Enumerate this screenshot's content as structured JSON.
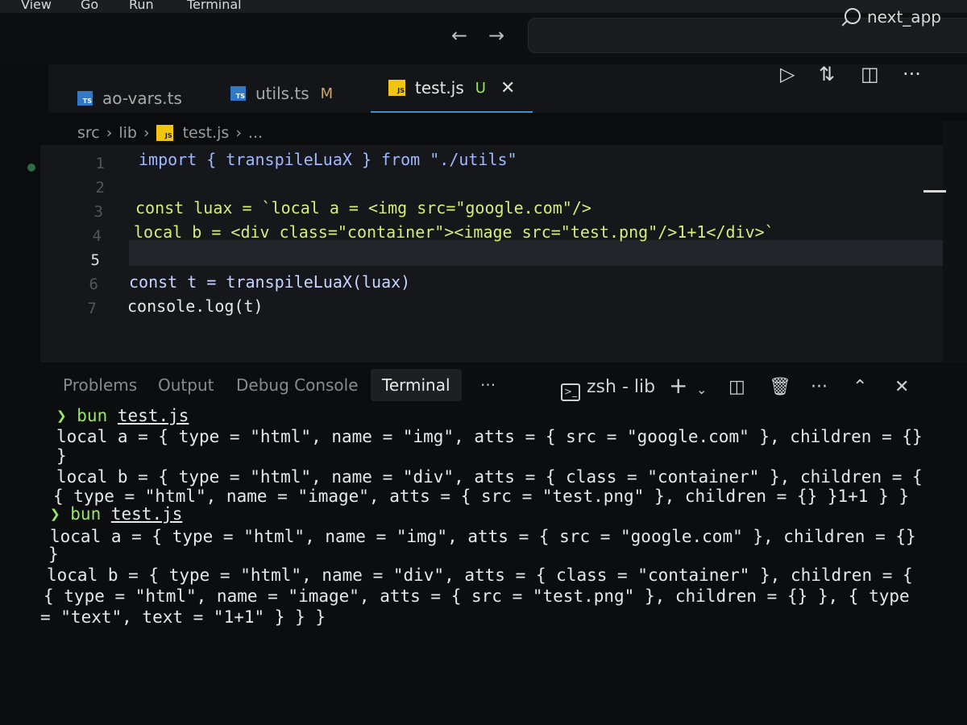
{
  "menu": [
    "View",
    "Go",
    "Run",
    "Terminal"
  ],
  "nav": {
    "back": "←",
    "forward": "→"
  },
  "app_name": "next_app",
  "tabs": [
    {
      "badge": "TS",
      "label": "ao-vars.ts",
      "status": ""
    },
    {
      "badge": "TS",
      "label": "utils.ts",
      "status": "M"
    },
    {
      "badge": "JS",
      "label": "test.js",
      "status": "U"
    }
  ],
  "breadcrumb": {
    "part1": "src",
    "part2": "lib",
    "file": "test.js",
    "more": "..."
  },
  "editor": {
    "line_numbers": [
      "1",
      "2",
      "3",
      "4",
      "5",
      "6",
      "7"
    ],
    "lines": [
      "import { transpileLuaX } from \"./utils\"",
      "",
      "const luax = `local a = <img src=\"google.com\"/>",
      "local b = <div class=\"container\"><image src=\"test.png\"/>1+1</div>`",
      "",
      "const t = transpileLuaX(luax)",
      "console.log(t)"
    ]
  },
  "panel": {
    "tabs": [
      "Problems",
      "Output",
      "Debug Console",
      "Terminal"
    ],
    "more": "···",
    "terminal_name": "zsh - lib",
    "terminal_lines": [
      {
        "prompt": "❯ bun",
        "cmd": "test.js"
      },
      {
        "text": "local a = { type = \"html\", name = \"img\", atts = { src = \"google.com\" }, children = {}"
      },
      {
        "text": "}"
      },
      {
        "text": "local b = { type = \"html\", name = \"div\", atts = { class = \"container\" }, children = {"
      },
      {
        "text": "{ type = \"html\", name = \"image\", atts = { src = \"test.png\" }, children = {} }1+1 } }"
      },
      {
        "prompt": "❯ bun",
        "cmd": "test.js"
      },
      {
        "text": "local a = { type = \"html\", name = \"img\", atts = { src = \"google.com\" }, children = {}"
      },
      {
        "text": "}"
      },
      {
        "text": "local b = { type = \"html\", name = \"div\", atts = { class = \"container\" }, children = {"
      },
      {
        "text": "{ type = \"html\", name = \"image\", atts = { src = \"test.png\" }, children = {} }, { type"
      },
      {
        "text": "= \"text\", text = \"1+1\" } } }"
      }
    ]
  },
  "colors": {
    "accent": "#3e8ed0",
    "prompt": "#9be564",
    "keyword": "#c792ea",
    "string": "#c3e88d"
  }
}
